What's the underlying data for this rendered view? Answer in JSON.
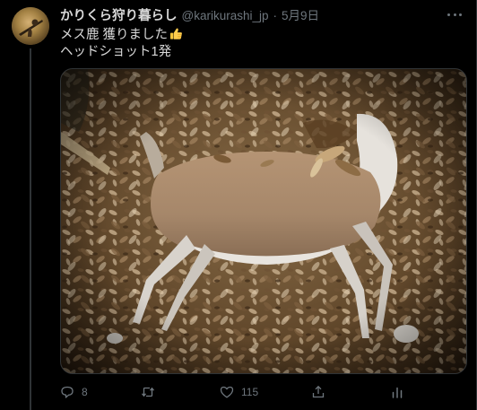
{
  "tweet": {
    "display_name": "かりくら狩り暮らし",
    "handle": "@karikurashi_jp",
    "separator": "·",
    "date": "5月9日",
    "text_line1": "メス鹿 獲りました",
    "text_line2": "ヘッドショット1発",
    "emoji": "thumbs-up-icon"
  },
  "actions": {
    "reply_count": "8",
    "retweet_count": "",
    "like_count": "115"
  },
  "colors": {
    "background": "#000000",
    "text": "#d9d9d9",
    "secondary": "#6e767d",
    "border": "#2f3336"
  }
}
